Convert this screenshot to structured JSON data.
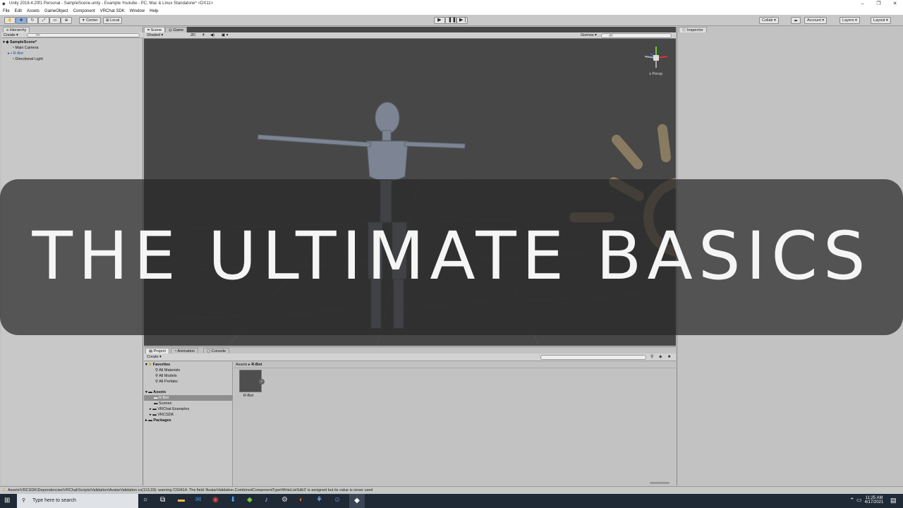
{
  "window": {
    "title": "Unity 2018.4.20f1 Personal - SampleScene.unity - Example Youtube - PC, Mac & Linux Standalone* <DX11>",
    "controls": [
      "–",
      "❐",
      "✕"
    ]
  },
  "menu": [
    "File",
    "Edit",
    "Assets",
    "GameObject",
    "Component",
    "VRChat SDK",
    "Window",
    "Help"
  ],
  "toolbar": {
    "center_label": "Center",
    "local_label": "Local",
    "collab_label": "Collab",
    "account_label": "Account",
    "layers_label": "Layers",
    "layout_label": "Layout"
  },
  "hierarchy": {
    "tab": "Hierarchy",
    "create": "Create",
    "search_placeholder": "All",
    "scene": "SampleScene*",
    "items": [
      "Main Camera",
      "R-Bot",
      "Directional Light"
    ]
  },
  "scene_view": {
    "tabs": [
      "Scene",
      "Game"
    ],
    "shading": "Shaded",
    "mode_2d": "2D",
    "gizmos": "Gizmos",
    "search_placeholder": "All",
    "persp": "Persp"
  },
  "inspector": {
    "tab": "Inspector"
  },
  "project": {
    "tabs": [
      "Project",
      "Animation",
      "Console"
    ],
    "create": "Create",
    "favorites": {
      "label": "Favorites",
      "items": [
        "All Materials",
        "All Models",
        "All Prefabs"
      ]
    },
    "assets": {
      "label": "Assets",
      "items": [
        "R-Bot",
        "Scenes",
        "VRChat Examples",
        "VRCSDK"
      ]
    },
    "packages": "Packages",
    "breadcrumb": [
      "Assets",
      "R-Bot"
    ],
    "grid_item": "R-Bot"
  },
  "status": {
    "message": "Assets\\VRCSDK\\Dependencies\\VRChat\\Scripts\\Validation\\AvatarValidation.cs(113,33): warning CS0414: The field 'AvatarValidation.CombinedComponentTypeWhiteListSdk3' is assigned but its value is never used"
  },
  "taskbar": {
    "search_placeholder": "Type here to search",
    "time": "11:25 AM",
    "date": "4/17/2021"
  },
  "overlay": {
    "headline": "THE ULTIMATE BASICS"
  }
}
